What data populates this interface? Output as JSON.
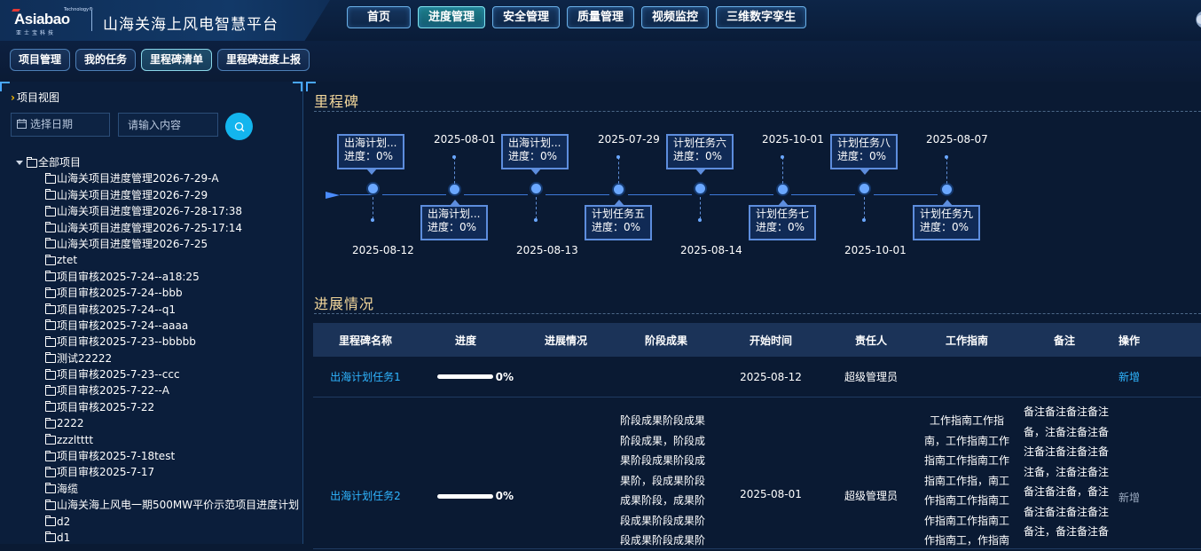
{
  "brand": {
    "logo_text": "Asiabao",
    "logo_tm": "Technology®",
    "logo_sub": "亚士宝科技",
    "title": "山海关海上风电智慧平台"
  },
  "nav": {
    "items": [
      "首页",
      "进度管理",
      "安全管理",
      "质量管理",
      "视频监控",
      "三维数字孪生"
    ],
    "active_index": 1
  },
  "subnav": {
    "tabs": [
      "项目管理",
      "我的任务",
      "里程碑清单",
      "里程碑进度上报"
    ],
    "active_index": 2
  },
  "left": {
    "header": "项目视图",
    "date_placeholder": "选择日期",
    "search_placeholder": "请输入内容",
    "tree_root": "全部项目",
    "tree_items": [
      "山海关项目进度管理2026-7-29-A",
      "山海关项目进度管理2026-7-29",
      "山海关项目进度管理2026-7-28-17:38",
      "山海关项目进度管理2026-7-25-17:14",
      "山海关项目进度管理2026-7-25",
      "ztet",
      "项目审核2025-7-24--a18:25",
      "项目审核2025-7-24--bbb",
      "项目审核2025-7-24--q1",
      "项目审核2025-7-24--aaaa",
      "项目审核2025-7-23--bbbbb",
      "测试22222",
      "项目审核2025-7-23--ccc",
      "项目审核2025-7-22--A",
      "项目审核2025-7-22",
      "2222",
      "zzzltttt",
      "项目审核2025-7-18test",
      "项目审核2025-7-17",
      "海缆",
      "山海关海上风电一期500MW平价示范项目进度计划",
      "d2",
      "d1"
    ]
  },
  "milestone": {
    "section_title": "里程碑",
    "top_cards": [
      {
        "name": "出海计划...",
        "progress": "进度：0%"
      },
      {
        "name": "出海计划...",
        "progress": "进度：0%"
      },
      {
        "name": "计划任务六",
        "progress": "进度：0%"
      },
      {
        "name": "计划任务八",
        "progress": "进度：0%"
      }
    ],
    "bottom_cards": [
      {
        "name": "出海计划...",
        "progress": "进度：0%"
      },
      {
        "name": "计划任务五",
        "progress": "进度：0%"
      },
      {
        "name": "计划任务七",
        "progress": "进度：0%"
      },
      {
        "name": "计划任务九",
        "progress": "进度：0%"
      }
    ],
    "top_dates": [
      "2025-08-01",
      "2025-07-29",
      "2025-10-01",
      "2025-08-07"
    ],
    "bottom_dates": [
      "2025-08-12",
      "2025-08-13",
      "2025-08-14",
      "2025-10-01"
    ]
  },
  "progress_section": {
    "title": "进展情况",
    "headers": [
      "里程碑名称",
      "进度",
      "进展情况",
      "阶段成果",
      "开始时间",
      "责任人",
      "工作指南",
      "备注",
      "操作"
    ],
    "rows": [
      {
        "name": "出海计划任务1",
        "progress_pct": "0%",
        "progress_value": 0,
        "status": "",
        "result_lines": [],
        "start": "2025-08-12",
        "owner": "超级管理员",
        "guide_lines": [],
        "remark_lines": [],
        "action": "新增"
      },
      {
        "name": "出海计划任务2",
        "progress_pct": "0%",
        "progress_value": 0,
        "status": "",
        "result_lines": [
          "阶段成果阶段成果",
          "阶段成果，阶段成",
          "果阶段成果阶段成",
          "果阶，段成果阶段",
          "成果阶段，成果阶",
          "段成果阶段成果阶",
          "段成果阶段成果阶"
        ],
        "start": "2025-08-01",
        "owner": "超级管理员",
        "guide_lines": [
          "工作指南工作指",
          "南，工作指南工作",
          "指南工作指南工作",
          "指南工作指，南工",
          "作指南工作指南工",
          "作指南工作指南工",
          "作指南工，作指南"
        ],
        "remark_lines": [
          "备注备注备注备注",
          "备，注备注备注备",
          "注备注备注备注备",
          "注备，注备注备注",
          "备注备注备，备注",
          "备注备注备注备注",
          "备注，备注备注备"
        ],
        "action": "新增"
      }
    ]
  },
  "colors": {
    "accent_link": "#2fb5ff",
    "section_title": "#f3d79b",
    "search_button": "#13b5ee"
  }
}
